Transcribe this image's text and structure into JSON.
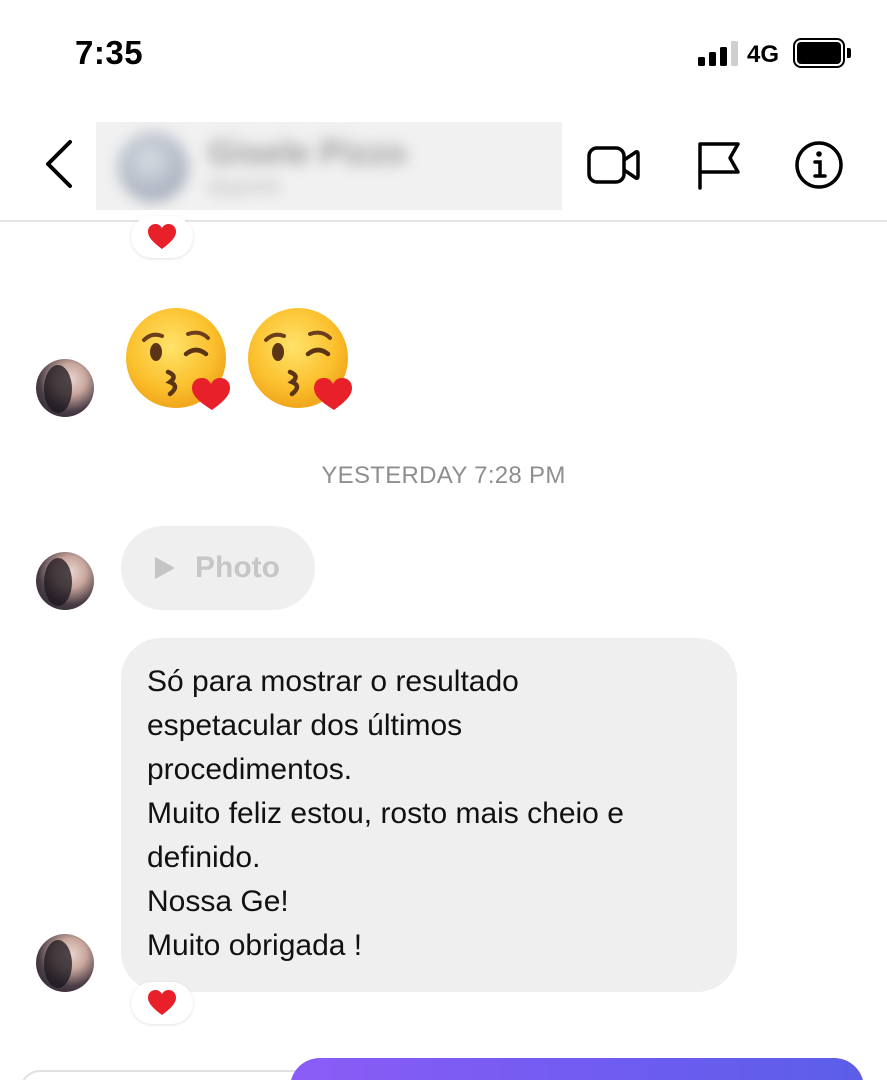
{
  "status_bar": {
    "time": "7:35",
    "network": "4G",
    "signal_bars": 3,
    "signal_max": 4,
    "battery_level": 0.9
  },
  "header": {
    "back_icon": "chevron-left-icon",
    "contact": {
      "name": "Gisele Pizzo",
      "handle": "@gisele"
    },
    "actions": [
      {
        "name": "video-call",
        "icon": "video-camera-icon"
      },
      {
        "name": "report",
        "icon": "flag-icon"
      },
      {
        "name": "details",
        "icon": "info-circle-icon"
      }
    ]
  },
  "messages": {
    "top_reaction": "heart-reaction-icon",
    "emoji_message": [
      "face-blowing-kiss-emoji",
      "face-blowing-kiss-emoji"
    ],
    "timestamp": "YESTERDAY 7:28 PM",
    "photo_label": "Photo",
    "text_message": "Só para mostrar o resultado\nespetacular dos últimos\nprocedimentos.\nMuito feliz estou, rosto mais cheio e\ndefinido.\nNossa Ge!\nMuito obrigada !",
    "text_reaction": "heart-reaction-icon"
  },
  "colors": {
    "received_bubble": "#efefef",
    "sent_bubble": "#6d5cf0",
    "timestamp_text": "#8e8e8e",
    "heart": "#e8202a"
  }
}
